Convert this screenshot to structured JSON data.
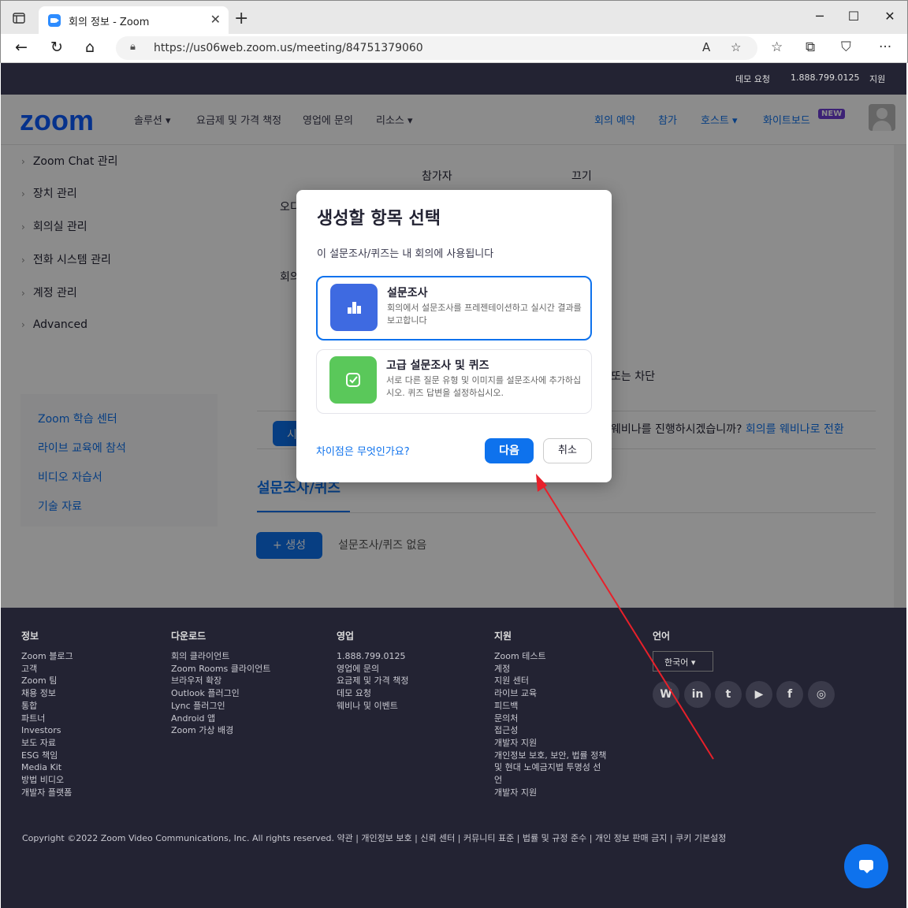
{
  "browser": {
    "tab_title": "회의 정보 - Zoom",
    "url": "https://us06web.zoom.us/meeting/84751379060"
  },
  "utility_bar": {
    "demo": "데모 요청",
    "phone": "1.888.799.0125",
    "support": "지원"
  },
  "nav": {
    "logo": "zoom",
    "items": [
      "솔루션 ▾",
      "요금제 및 가격 책정",
      "영업에 문의",
      "리소스 ▾"
    ],
    "right": {
      "schedule": "회의 예약",
      "join": "참가",
      "host": "호스트 ▾",
      "whiteboard": "화이트보드",
      "new_badge": "NEW"
    }
  },
  "sidebar": {
    "items": [
      "Zoom Chat 관리",
      "장치 관리",
      "회의실 관리",
      "전화 시스템 관리",
      "계정 관리",
      "Advanced"
    ],
    "learn": [
      "Zoom 학습 센터",
      "라이브 교육에 참석",
      "비디오 자습서",
      "기술 자료"
    ]
  },
  "background": {
    "participants": "참가자",
    "off": "끄기",
    "audio_partial": "오디",
    "meeting_partial": "회의",
    "block_partial": "또는 차단",
    "start_partial": "시",
    "webinar_prompt": "웨비나를 진행하시겠습니까?",
    "webinar_link": "회의를 웨비나로 전환",
    "poll_title": "설문조사/퀴즈",
    "create_button": "+ 생성",
    "no_polls": "설문조사/퀴즈 없음"
  },
  "dialog": {
    "title": "생성할 항목 선택",
    "subtitle": "이 설문조사/퀴즈는 내 회의에 사용됩니다",
    "options": [
      {
        "title": "설문조사",
        "desc": "회의에서 설문조사를 프레젠테이션하고 실시간 결과를 보고합니다",
        "icon": "bar-chart-icon",
        "color": "#3e6ae1",
        "selected": true
      },
      {
        "title": "고급 설문조사 및 퀴즈",
        "desc": "서로 다른 질문 유형 및 이미지를 설문조사에 추가하십시오. 퀴즈 답변을 설정하십시오.",
        "icon": "checkbox-icon",
        "color": "#5ac85a",
        "selected": false
      }
    ],
    "difference_link": "차이점은 무엇인가요?",
    "next": "다음",
    "cancel": "취소"
  },
  "footer": {
    "columns": [
      {
        "title": "정보",
        "items": [
          "Zoom 블로그",
          "고객",
          "Zoom 팀",
          "채용 정보",
          "통합",
          "파트너",
          "Investors",
          "보도 자료",
          "ESG 책임",
          "Media Kit",
          "방법 비디오",
          "개발자 플랫폼"
        ]
      },
      {
        "title": "다운로드",
        "items": [
          "회의 클라이언트",
          "Zoom Rooms 클라이언트",
          "브라우저 확장",
          "Outlook 플러그인",
          "Lync 플러그인",
          "Android 앱",
          "Zoom 가상 배경"
        ]
      },
      {
        "title": "영업",
        "items": [
          "1.888.799.0125",
          "영업에 문의",
          "요금제 및 가격 책정",
          "데모 요청",
          "웨비나 및 이벤트"
        ]
      },
      {
        "title": "지원",
        "items": [
          "Zoom 테스트",
          "계정",
          "지원 센터",
          "라이브 교육",
          "피드백",
          "문의처",
          "접근성",
          "개발자 지원",
          "개인정보 보호, 보안, 법률 정책",
          "및 현대 노예금지법 투명성 선",
          "언",
          "개발자 지원"
        ]
      }
    ],
    "language_title": "언어",
    "language": "한국어 ▾",
    "social": [
      "W",
      "in",
      "t",
      "▶",
      "f",
      "◎"
    ],
    "copyright": "Copyright ©2022 Zoom Video Communications, Inc. All rights reserved.  약관  |  개인정보 보호  |  신뢰 센터  |  커뮤니티 표준  |  법률 및 규정 준수  |  개인 정보 판매 금지  |  쿠키 기본설정"
  },
  "annotation_color": "#e8202a"
}
